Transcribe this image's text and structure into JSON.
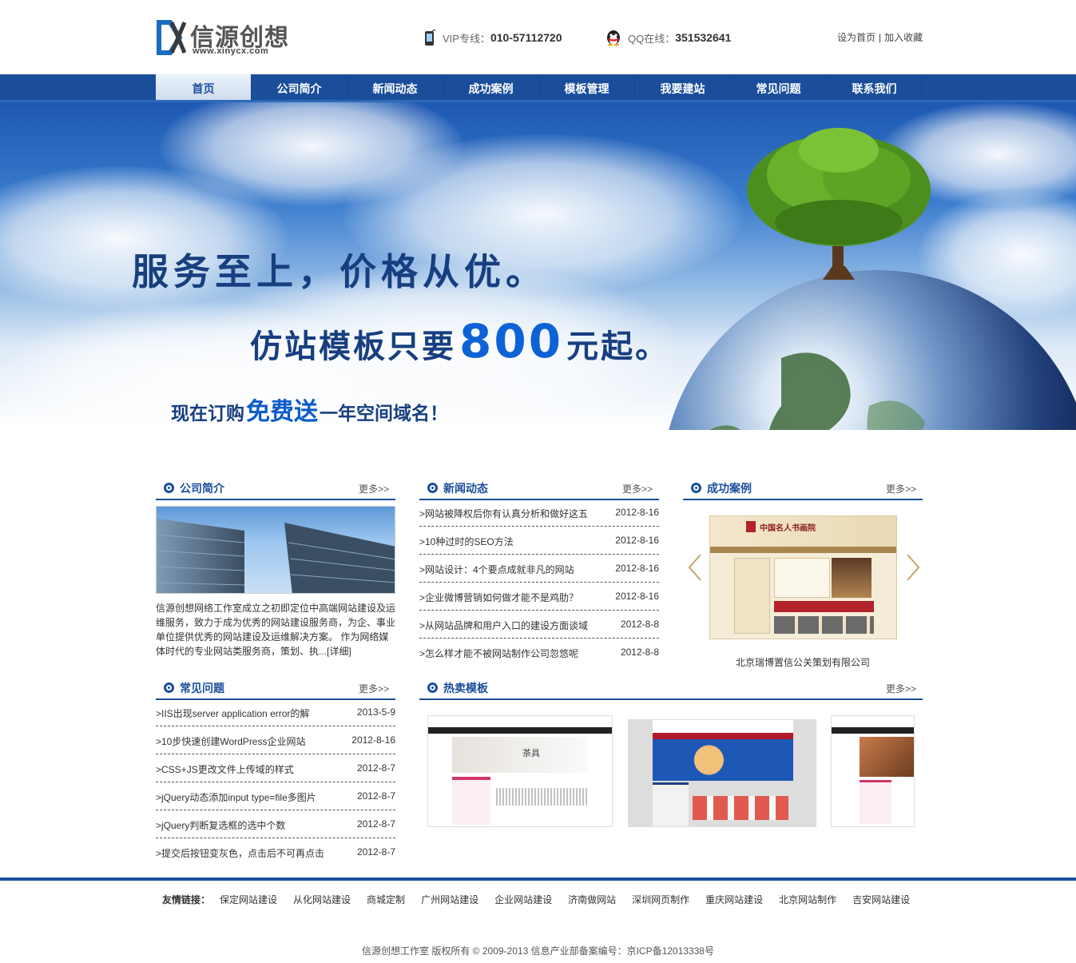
{
  "header": {
    "logo_text": "信源创想",
    "logo_url": "www.xinycx.com",
    "vip_label": "VIP专线：",
    "vip_number": "010-57112720",
    "qq_label": "QQ在线：",
    "qq_number": "351532641",
    "set_home": "设为首页",
    "separator": "|",
    "add_fav": "加入收藏"
  },
  "nav": {
    "items": [
      "首页",
      "公司简介",
      "新闻动态",
      "成功案例",
      "模板管理",
      "我要建站",
      "常见问题",
      "联系我们"
    ]
  },
  "banner": {
    "line1": "服务至上，价格从优。",
    "line2_pre": "仿站模板只要",
    "line2_price": "800",
    "line2_post": "元起。",
    "line3_pre": "现在订购",
    "line3_free": "免费送",
    "line3_post": "一年空间域名！"
  },
  "about": {
    "title": "公司简介",
    "more": "更多>>",
    "text": "信源创想网络工作室成立之初即定位中高端网站建设及运维服务，致力于成为优秀的网站建设服务商，为企、事业单位提供优秀的网站建设及运维解决方案。 作为网络媒体时代的专业网站类服务商，策划、执...",
    "detail": "[详细]"
  },
  "news": {
    "title": "新闻动态",
    "more": "更多>>",
    "items": [
      {
        "title": ">网站被降权后你有认真分析和做好这五",
        "date": "2012-8-16"
      },
      {
        "title": ">10种过时的SEO方法",
        "date": "2012-8-16"
      },
      {
        "title": ">网站设计：4个要点成就非凡的网站",
        "date": "2012-8-16"
      },
      {
        "title": ">企业微博营销如何做才能不是鸡肋？",
        "date": "2012-8-16"
      },
      {
        "title": ">从网站品牌和用户入口的建设方面谈域",
        "date": "2012-8-8"
      },
      {
        "title": ">怎么样才能不被网站制作公司忽悠呢",
        "date": "2012-8-8"
      }
    ]
  },
  "cases": {
    "title": "成功案例",
    "more": "更多>>",
    "case_name": "北京瑞博置信公关策划有限公司",
    "case_header": "中国名人书画院"
  },
  "faq": {
    "title": "常见问题",
    "more": "更多>>",
    "items": [
      {
        "title": ">IIS出现server application error的解",
        "date": "2013-5-9"
      },
      {
        "title": ">10步快速创建WordPress企业网站",
        "date": "2012-8-16"
      },
      {
        "title": ">CSS+JS更改文件上传域的样式",
        "date": "2012-8-7"
      },
      {
        "title": ">jQuery动态添加input type=file多图片",
        "date": "2012-8-7"
      },
      {
        "title": ">jQuery判断复选框的选中个数",
        "date": "2012-8-7"
      },
      {
        "title": ">提交后按钮变灰色，点击后不可再点击",
        "date": "2012-8-7"
      }
    ]
  },
  "templates": {
    "title": "热卖模板",
    "more": "更多>>",
    "tpl1_label": "茶具"
  },
  "footer": {
    "links_label": "友情链接：",
    "links": [
      "保定网站建设",
      "从化网站建设",
      "商城定制",
      "广州网站建设",
      "企业网站建设",
      "济南做网站",
      "深圳网页制作",
      "重庆网站建设",
      "北京网站制作",
      "吉安网站建设"
    ],
    "copyright": "信源创想工作室 版权所有 © 2009-2013 信息产业部备案编号：京ICP备12013338号"
  },
  "colors": {
    "brand_blue": "#1a4e9b",
    "price_blue": "#0d63d6"
  }
}
